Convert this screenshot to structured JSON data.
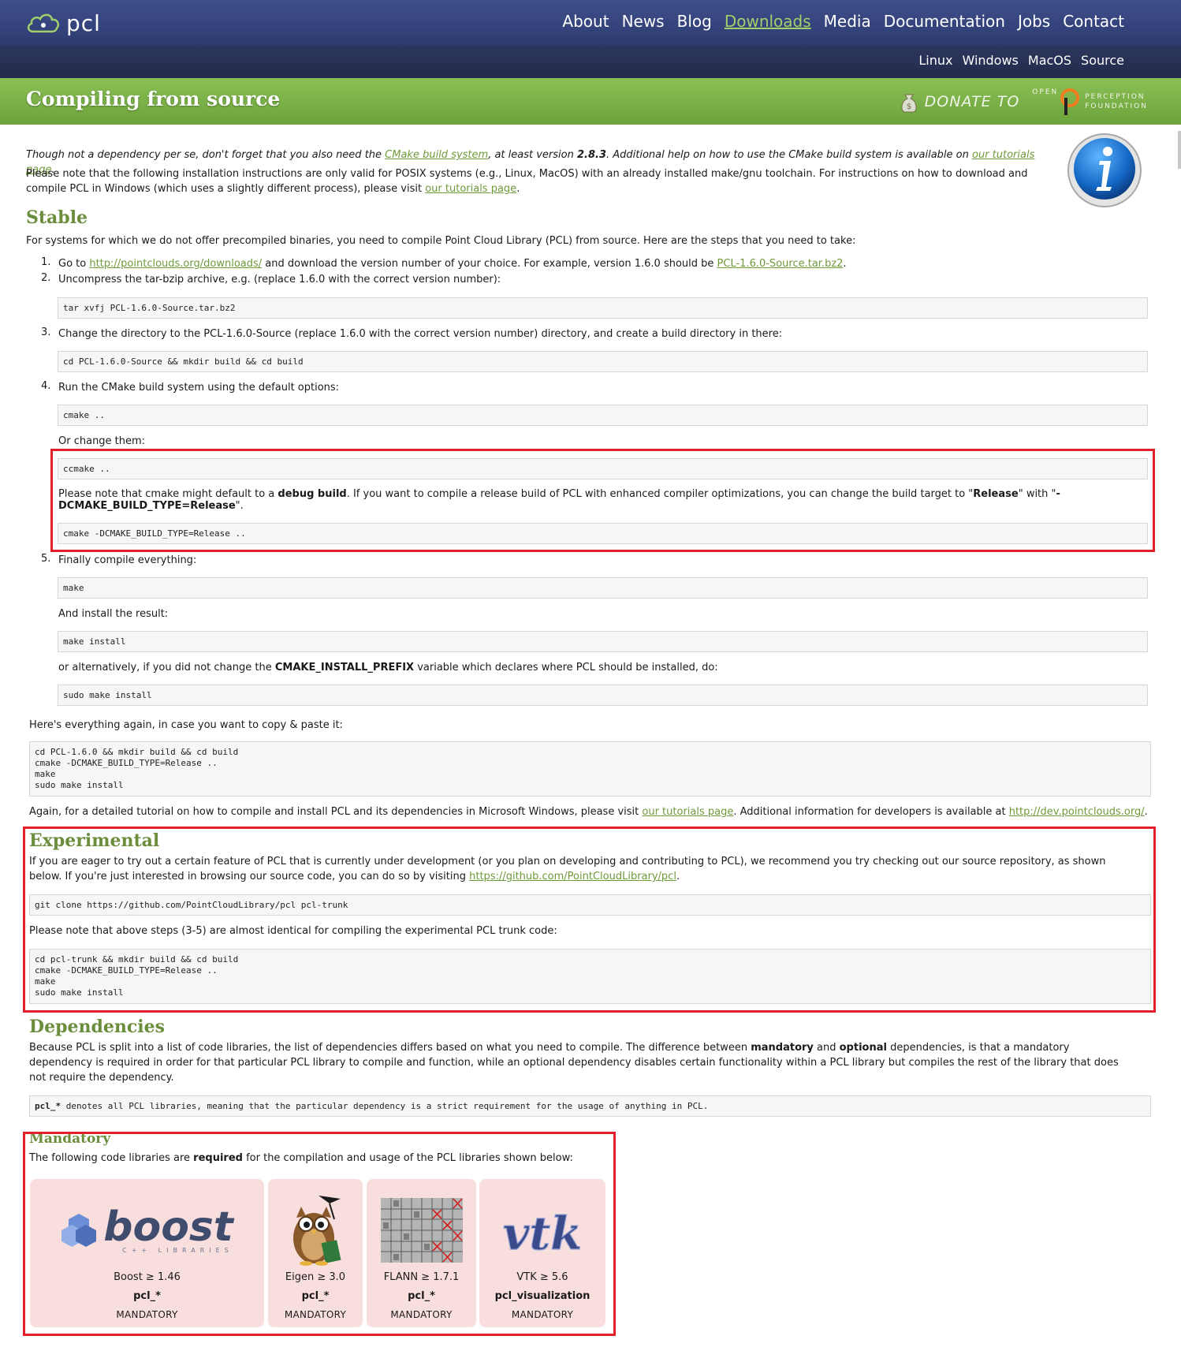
{
  "header": {
    "logo_text": "pcl",
    "nav": [
      "About",
      "News",
      "Blog",
      "Downloads",
      "Media",
      "Documentation",
      "Jobs",
      "Contact"
    ],
    "active_nav": "Downloads",
    "subnav": [
      "Linux",
      "Windows",
      "MacOS",
      "Source"
    ]
  },
  "banner": {
    "title": "Compiling from source",
    "donate_text": "DONATE TO",
    "org_open": "OPEN",
    "org_line1": "PERCEPTION",
    "org_line2": "FOUNDATION"
  },
  "intro": {
    "p1_a": "Though not a dependency per se, don't forget that you also need the ",
    "p1_link1": "CMake build system",
    "p1_b": ", at least version ",
    "p1_version": "2.8.3",
    "p1_c": ". Additional help on how to use the CMake build system is available on ",
    "p1_link2": "our tutorials page",
    "p1_d": ".",
    "p2_a": "Please note that the following installation instructions are only valid for POSIX systems (e.g., Linux, MacOS) with an already installed make/gnu toolchain. For instructions on how to download and compile PCL in Windows (which uses a slightly different process), please visit ",
    "p2_link": "our tutorials page",
    "p2_b": "."
  },
  "stable": {
    "heading": "Stable",
    "intro": "For systems for which we do not offer precompiled binaries, you need to compile Point Cloud Library (PCL) from source. Here are the steps that you need to take:",
    "step1_a": "Go to ",
    "step1_link": "http://pointclouds.org/downloads/",
    "step1_b": " and download the version number of your choice. For example, version 1.6.0 should be ",
    "step1_link2": "PCL-1.6.0-Source.tar.bz2",
    "step1_c": ".",
    "step2": "Uncompress the tar-bzip archive, e.g. (replace 1.6.0 with the correct version number):",
    "code2": "tar xvfj PCL-1.6.0-Source.tar.bz2",
    "step3": "Change the directory to the PCL-1.6.0-Source (replace 1.6.0 with the correct version number) directory, and create a build directory in there:",
    "code3": "cd PCL-1.6.0-Source && mkdir build && cd build",
    "step4": "Run the CMake build system using the default options:",
    "code4": "cmake ..",
    "or_change": "Or change them:",
    "code4b": "ccmake ..",
    "note_a": "Please note that cmake might default to a ",
    "note_bold1": "debug build",
    "note_b": ". If you want to compile a release build of PCL with enhanced compiler optimizations, you can change the build target to \"",
    "note_bold2": "Release",
    "note_c": "\" with \"",
    "note_bold3": "-DCMAKE_BUILD_TYPE=Release",
    "note_d": "\".",
    "code4c": "cmake -DCMAKE_BUILD_TYPE=Release ..",
    "step5": "Finally compile everything:",
    "code5": "make",
    "install_text": "And install the result:",
    "code5b": "make install",
    "alt_a": "or alternatively, if you did not change the ",
    "alt_bold": "CMAKE_INSTALL_PREFIX",
    "alt_b": " variable which declares where PCL should be installed, do:",
    "code5c": "sudo make install",
    "again_text": "Here's everything again, in case you want to copy & paste it:",
    "code_all": "cd PCL-1.6.0 && mkdir build && cd build\ncmake -DCMAKE_BUILD_TYPE=Release ..\nmake\nsudo make install",
    "outro_a": "Again, for a detailed tutorial on how to compile and install PCL and its dependencies in Microsoft Windows, please visit ",
    "outro_link1": "our tutorials page",
    "outro_b": ". Additional information for developers is available at ",
    "outro_link2": "http://dev.pointclouds.org/",
    "outro_c": "."
  },
  "experimental": {
    "heading": "Experimental",
    "p1_a": "If you are eager to try out a certain feature of PCL that is currently under development (or you plan on developing and contributing to PCL), we recommend you try checking out our source repository, as shown below. If you're just interested in browsing our source code, you can do so by visiting ",
    "p1_link": "https://github.com/PointCloudLibrary/pcl",
    "p1_b": ".",
    "code1": "git clone https://github.com/PointCloudLibrary/pcl pcl-trunk",
    "p2": "Please note that above steps (3-5) are almost identical for compiling the experimental PCL trunk code:",
    "code2": "cd pcl-trunk && mkdir build && cd build\ncmake -DCMAKE_BUILD_TYPE=Release ..\nmake\nsudo make install"
  },
  "dependencies": {
    "heading": "Dependencies",
    "p_a": "Because PCL is split into a list of code libraries, the list of dependencies differs based on what you need to compile. The difference between ",
    "p_bold1": "mandatory",
    "p_b": " and ",
    "p_bold2": "optional",
    "p_c": " dependencies, is that a mandatory dependency is required in order for that particular PCL library to compile and function, while an optional dependency disables certain functionality within a PCL library but compiles the rest of the library that does not require the dependency.",
    "code_bold": "pcl_*",
    "code_rest": " denotes all PCL libraries, meaning that the particular dependency is a strict requirement for the usage of anything in PCL."
  },
  "mandatory": {
    "heading": "Mandatory",
    "p_a": "The following code libraries are ",
    "p_bold": "required",
    "p_b": " for the compilation and usage of the PCL libraries shown below:",
    "cards": [
      {
        "logo_text": "boost",
        "logo_sub": "C++  LIBRARIES",
        "version": "Boost ≥ 1.46",
        "lib": "pcl_*",
        "status": "MANDATORY"
      },
      {
        "version": "Eigen ≥ 3.0",
        "lib": "pcl_*",
        "status": "MANDATORY"
      },
      {
        "version": "FLANN ≥ 1.7.1",
        "lib": "pcl_*",
        "status": "MANDATORY"
      },
      {
        "logo_text": "vtk",
        "version": "VTK ≥ 5.6",
        "lib": "pcl_visualization",
        "status": "MANDATORY"
      }
    ]
  },
  "colors": {
    "nav_bg": "#3f4f8a",
    "subnav_bg": "#2d375e",
    "banner_green": "#7ab148",
    "heading_green": "#6b8d3c",
    "highlight_red": "#e0202a",
    "card_pink": "#f9dede"
  }
}
